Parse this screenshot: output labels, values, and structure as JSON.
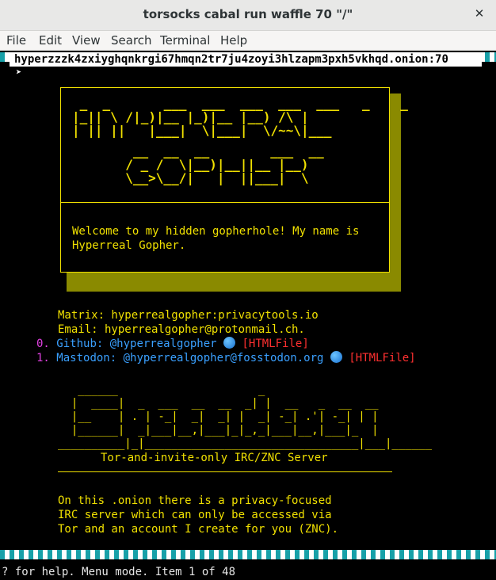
{
  "window": {
    "title": "torsocks cabal run waffle 70 \"/\""
  },
  "menu": [
    "File",
    "Edit",
    "View",
    "Search",
    "Terminal",
    "Help"
  ],
  "address": "hyperzzzk4zxiyghqnkrgi67hmqn2tr7ju4zoyi3hlzapm3pxh5vkhqd.onion:70",
  "cursor_glyph": "➤",
  "banner": {
    "art": [
      " _  _       ___  ___  ___  ___  ___   _    _",
      "|_|| \\ /|_)|__ |_)|__ |__) /\\ |   ",
      "| || ||   |___|  \\|___|  \\/~~\\|___",
      "   __  __  __        ___  __",
      "  / _ /  \\|__)|__||__ |__)",
      "  \\__>\\__/|   |  ||___|  \\"
    ],
    "welcome": "Welcome to my hidden gopherhole! My name is\nHyperreal Gopher."
  },
  "contacts": {
    "matrix": "Matrix: hyperrealgopher:privacytools.io",
    "email": "Email: hyperrealgopher@protonmail.ch.",
    "links": [
      {
        "index": "0.",
        "text": "Github: @hyperrealgopher",
        "type": "[HTMLFile]"
      },
      {
        "index": "1.",
        "text": "Mastodon: @hyperrealgopher@fosstodon.org",
        "type": "[HTMLFile]"
      }
    ]
  },
  "spectacle_art": [
    "   ______                     _",
    "  |  ____|  _  ___  __  __  _| |  __   _  __  __",
    "  |__    | . | -_|  _|  _| |  _| -_| .'| -_| | |",
    "  |______|  _|___|__,|___|_|_,_|___|__,|___|_  |",
    "__________|_|________________________________|___|______"
  ],
  "server": {
    "tagline": "Tor-and-invite-only IRC/ZNC Server",
    "description": "On this .onion there is a privacy-focused\nIRC server which can only be accessed via\nTor and an account I create for you (ZNC)."
  },
  "status_line": "? for help. Menu mode. Item 1 of 48",
  "colors": {
    "yellow": "#f0e000",
    "link_blue": "#3aa0ff",
    "index_magenta": "#e040e0",
    "type_red": "#ff3030",
    "checker_teal": "#17a0a8"
  }
}
